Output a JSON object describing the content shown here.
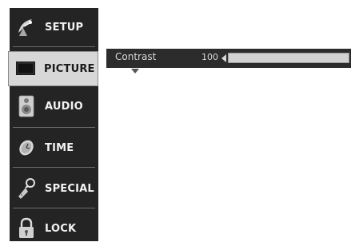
{
  "menu": {
    "items": [
      {
        "label": "SETUP",
        "icon": "satellite-dish-icon",
        "selected": false
      },
      {
        "label": "PICTURE",
        "icon": "tv-screen-icon",
        "selected": true
      },
      {
        "label": "AUDIO",
        "icon": "speaker-icon",
        "selected": false
      },
      {
        "label": "TIME",
        "icon": "clock-icon",
        "selected": false
      },
      {
        "label": "SPECIAL",
        "icon": "key-icon",
        "selected": false
      },
      {
        "label": "LOCK",
        "icon": "padlock-icon",
        "selected": false
      }
    ]
  },
  "submenu": {
    "contrast": {
      "label": "Contrast",
      "value": "100",
      "level_percent": 100
    }
  },
  "colors": {
    "menu_background": "#242424",
    "selected_background": "#d7d7d7",
    "submenu_background": "#2c2c2c",
    "slider_fill": "#d2d2d2"
  }
}
